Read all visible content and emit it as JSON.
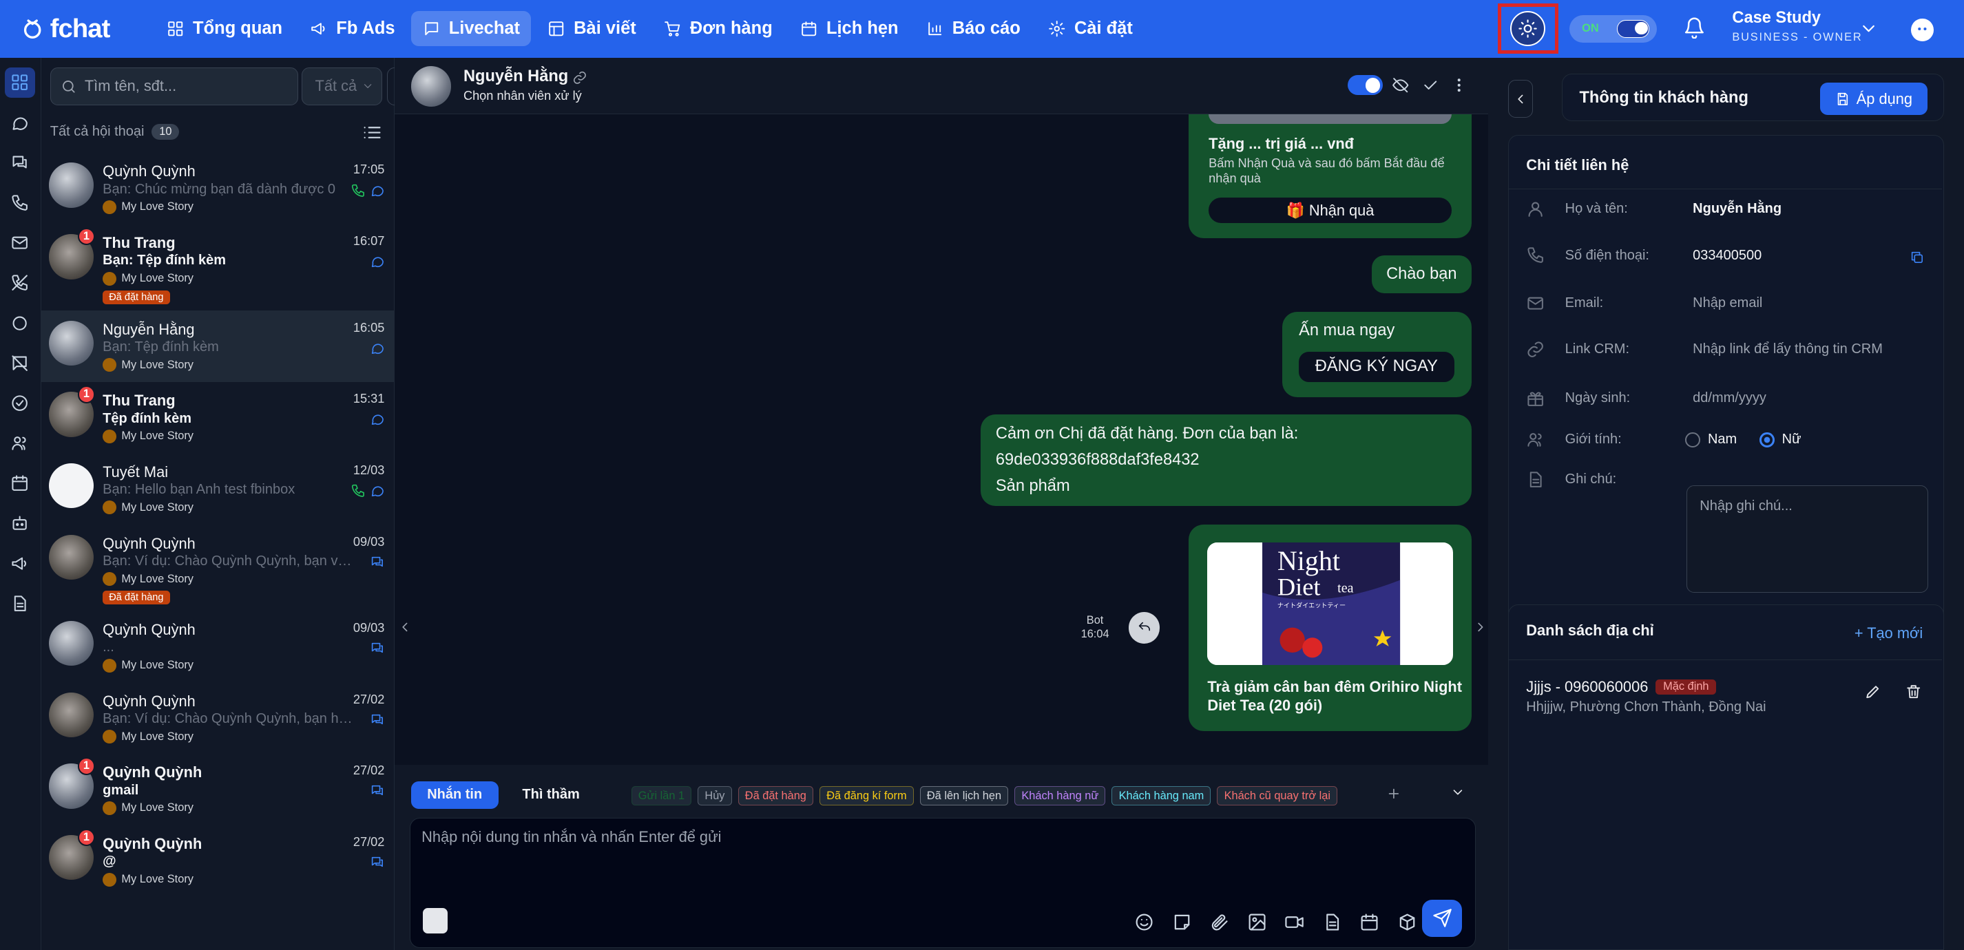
{
  "brand": {
    "name": "fchat"
  },
  "nav": [
    {
      "label": "Tổng quan",
      "icon": "grid-icon"
    },
    {
      "label": "Fb Ads",
      "icon": "megaphone-icon"
    },
    {
      "label": "Livechat",
      "icon": "message-square-icon",
      "active": true
    },
    {
      "label": "Bài viết",
      "icon": "layout-icon"
    },
    {
      "label": "Đơn hàng",
      "icon": "cart-icon"
    },
    {
      "label": "Lịch hẹn",
      "icon": "calendar-icon"
    },
    {
      "label": "Báo cáo",
      "icon": "bar-chart-icon"
    },
    {
      "label": "Cài đặt",
      "icon": "settings-icon"
    }
  ],
  "topbar": {
    "toggle_label": "ON",
    "account_name": "Case Study",
    "account_role": "BUSINESS - OWNER"
  },
  "conversations_panel": {
    "search_placeholder": "Tìm tên, sđt...",
    "filter_value": "Tất cả",
    "header_label": "Tất cả hội thoại",
    "count": "10",
    "items": [
      {
        "name": "Quỳnh Quỳnh",
        "time": "17:05",
        "preview": "Bạn: Chúc mừng bạn đã dành được 0",
        "page": "My Love Story",
        "unread": "",
        "tag": "",
        "bold": false
      },
      {
        "name": "Thu Trang",
        "time": "16:07",
        "preview": "Bạn: Tệp đính kèm",
        "page": "My Love Story",
        "unread": "1",
        "tag": "Đã đặt hàng",
        "bold": true
      },
      {
        "name": "Nguyễn Hằng",
        "time": "16:05",
        "preview": "Bạn: Tệp đính kèm",
        "page": "My Love Story",
        "unread": "",
        "tag": "",
        "bold": false
      },
      {
        "name": "Thu Trang",
        "time": "15:31",
        "preview": "Tệp đính kèm",
        "page": "My Love Story",
        "unread": "1",
        "tag": "",
        "bold": true
      },
      {
        "name": "Tuyết Mai",
        "time": "12/03",
        "preview": "Bạn: Hello bạn Anh test fbinbox",
        "page": "My Love Story",
        "unread": "",
        "tag": "",
        "bold": false
      },
      {
        "name": "Quỳnh Quỳnh",
        "time": "09/03",
        "preview": "Bạn: Ví dụ: Chào Quỳnh Quỳnh, bạn vui lòn...",
        "page": "My Love Story",
        "unread": "",
        "tag": "Đã đặt hàng",
        "bold": false
      },
      {
        "name": "Quỳnh Quỳnh",
        "time": "09/03",
        "preview": "...",
        "page": "My Love Story",
        "unread": "",
        "tag": "",
        "bold": false
      },
      {
        "name": "Quỳnh Quỳnh",
        "time": "27/02",
        "preview": "Bạn: Ví dụ: Chào Quỳnh Quỳnh, bạn hãy kiể...",
        "page": "My Love Story",
        "unread": "",
        "tag": "",
        "bold": false
      },
      {
        "name": "Quỳnh Quỳnh",
        "time": "27/02",
        "preview": "gmail",
        "page": "My Love Story",
        "unread": "1",
        "tag": "",
        "bold": true
      },
      {
        "name": "Quỳnh Quỳnh",
        "time": "27/02",
        "preview": "@",
        "page": "My Love Story",
        "unread": "1",
        "tag": "",
        "bold": true
      }
    ]
  },
  "chat": {
    "contact_name": "Nguyễn Hằng",
    "assign_label": "Chọn nhân viên xử lý",
    "gift_title": "Tặng ... trị giá ... vnđ",
    "gift_desc": "Bấm Nhận Quà và sau đó bấm Bắt đầu để nhận quà",
    "gift_button": "🎁 Nhận quà",
    "greeting": "Chào bạn",
    "buy_text": "Ấn mua ngay",
    "register_button": "ĐĂNG KÝ NGAY",
    "order_line1": "Cảm ơn Chị đã đặt hàng. Đơn của bạn là:",
    "order_line2": "69de033936f888daf3fe8432",
    "order_line3": "Sản phẩm",
    "product_title": "Trà giảm cân ban đêm Orihiro Night Diet Tea (20 gói)",
    "product_image_text": {
      "line1": "Night",
      "line2": "Diet",
      "line3": "tea",
      "line4": "ナイトダイエットティー"
    },
    "bot_label": "Bot",
    "bot_time": "16:04"
  },
  "composer": {
    "tabs": [
      "Nhắn tin",
      "Thì thầm"
    ],
    "tags": [
      {
        "label": "Gửi lần 1",
        "color": "#166534"
      },
      {
        "label": "Hủy",
        "color": "#9ca3af"
      },
      {
        "label": "Đã đặt hàng",
        "color": "#f87171"
      },
      {
        "label": "Đã đăng kí form",
        "color": "#facc15"
      },
      {
        "label": "Đã lên lịch hẹn",
        "color": "#d1d5db"
      },
      {
        "label": "Khách hàng nữ",
        "color": "#c084fc"
      },
      {
        "label": "Khách hàng nam",
        "color": "#67e8f9"
      },
      {
        "label": "Khách cũ quay trở lại",
        "color": "#f87171"
      }
    ],
    "placeholder": "Nhập nội dung tin nhắn và nhấn Enter để gửi"
  },
  "customer": {
    "panel_title": "Thông tin khách hàng",
    "apply_label": "Áp dụng",
    "contact_section": "Chi tiết liên hệ",
    "name_label": "Họ và tên:",
    "name_value": "Nguyễn Hằng",
    "phone_label": "Số điện thoại:",
    "phone_value": "033400500",
    "email_label": "Email:",
    "email_placeholder": "Nhập email",
    "crm_label": "Link CRM:",
    "crm_placeholder": "Nhập link để lấy thông tin CRM",
    "birthday_label": "Ngày sinh:",
    "birthday_placeholder": "dd/mm/yyyy",
    "gender_label": "Giới tính:",
    "gender_male": "Nam",
    "gender_female": "Nữ",
    "gender_selected": "Nữ",
    "note_label": "Ghi chú:",
    "note_placeholder": "Nhập ghi chú...",
    "address_section": "Danh sách địa chỉ",
    "create_label": "+ Tạo mới",
    "address_name": "Jjjjs - 0960060006",
    "address_default": "Mặc định",
    "address_detail": "Hhjjjw, Phường Chơn Thành, Đồng Nai"
  }
}
